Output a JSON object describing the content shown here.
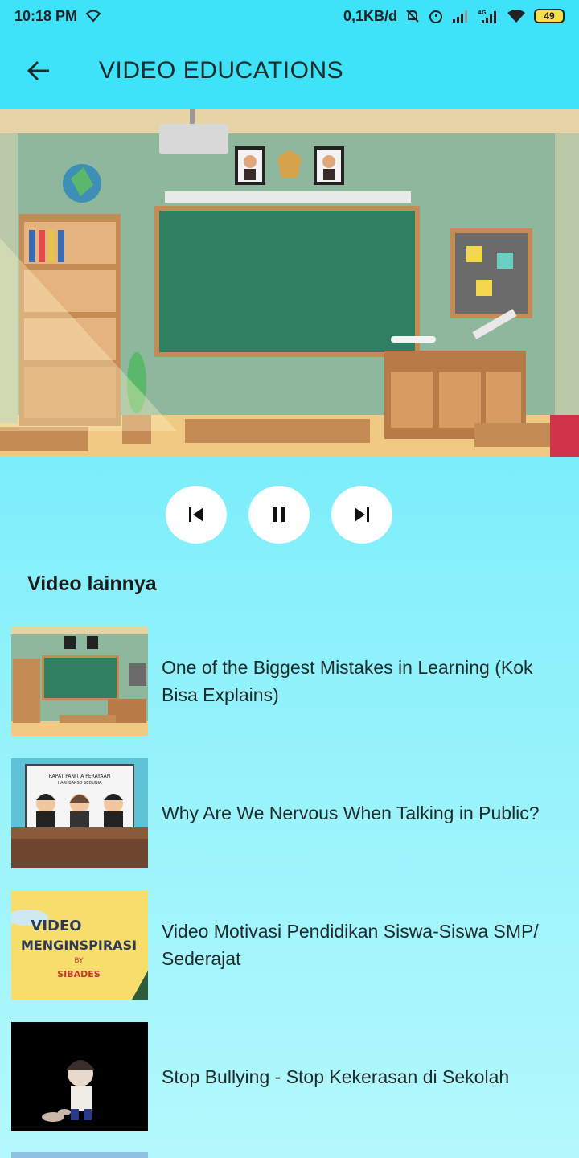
{
  "status_bar": {
    "time": "10:18 PM",
    "network_speed": "0,1KB/d",
    "battery": "49",
    "icons": [
      "wifi-icon",
      "mute-icon",
      "alarm-icon",
      "signal-icon",
      "signal-4g-icon",
      "wifi-icon",
      "battery-icon"
    ]
  },
  "app_bar": {
    "title": "VIDEO EDUCATIONS",
    "back_icon": "arrow-left-icon"
  },
  "player": {
    "controls": [
      "skip-previous-icon",
      "pause-icon",
      "skip-next-icon"
    ]
  },
  "section": {
    "title": "Video lainnya"
  },
  "videos": [
    {
      "title": "One of the Biggest Mistakes in Learning (Kok Bisa Explains)"
    },
    {
      "title": "Why Are We Nervous When Talking in Public?",
      "thumb_text": [
        "RAPAT PANITIA PERAYAAN",
        "HARI BAKSO SEDUNIA"
      ]
    },
    {
      "title": "Video Motivasi Pendidikan Siswa-Siswa SMP/ Sederajat",
      "thumb_text": [
        "VIDEO",
        "MENGINSPIRASI",
        "BY",
        "SIBADES"
      ]
    },
    {
      "title": "Stop Bullying - Stop Kekerasan di Sekolah"
    }
  ],
  "colors": {
    "app_bar": "#3fe3f9",
    "background_top": "#4ee6fa",
    "background_bottom": "#b3f8fc"
  }
}
